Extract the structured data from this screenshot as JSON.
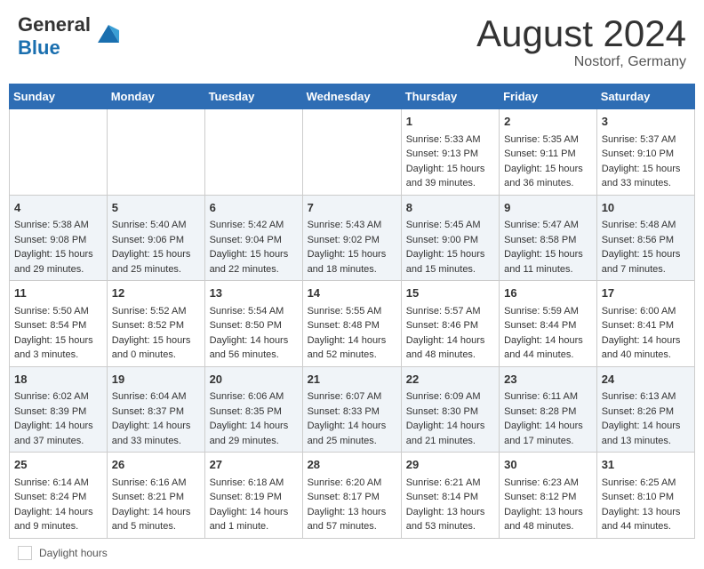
{
  "header": {
    "logo_line1": "General",
    "logo_line2": "Blue",
    "month_title": "August 2024",
    "location": "Nostorf, Germany"
  },
  "days_of_week": [
    "Sunday",
    "Monday",
    "Tuesday",
    "Wednesday",
    "Thursday",
    "Friday",
    "Saturday"
  ],
  "weeks": [
    [
      {
        "num": "",
        "sunrise": "",
        "sunset": "",
        "daylight": ""
      },
      {
        "num": "",
        "sunrise": "",
        "sunset": "",
        "daylight": ""
      },
      {
        "num": "",
        "sunrise": "",
        "sunset": "",
        "daylight": ""
      },
      {
        "num": "",
        "sunrise": "",
        "sunset": "",
        "daylight": ""
      },
      {
        "num": "1",
        "sunrise": "Sunrise: 5:33 AM",
        "sunset": "Sunset: 9:13 PM",
        "daylight": "Daylight: 15 hours and 39 minutes."
      },
      {
        "num": "2",
        "sunrise": "Sunrise: 5:35 AM",
        "sunset": "Sunset: 9:11 PM",
        "daylight": "Daylight: 15 hours and 36 minutes."
      },
      {
        "num": "3",
        "sunrise": "Sunrise: 5:37 AM",
        "sunset": "Sunset: 9:10 PM",
        "daylight": "Daylight: 15 hours and 33 minutes."
      }
    ],
    [
      {
        "num": "4",
        "sunrise": "Sunrise: 5:38 AM",
        "sunset": "Sunset: 9:08 PM",
        "daylight": "Daylight: 15 hours and 29 minutes."
      },
      {
        "num": "5",
        "sunrise": "Sunrise: 5:40 AM",
        "sunset": "Sunset: 9:06 PM",
        "daylight": "Daylight: 15 hours and 25 minutes."
      },
      {
        "num": "6",
        "sunrise": "Sunrise: 5:42 AM",
        "sunset": "Sunset: 9:04 PM",
        "daylight": "Daylight: 15 hours and 22 minutes."
      },
      {
        "num": "7",
        "sunrise": "Sunrise: 5:43 AM",
        "sunset": "Sunset: 9:02 PM",
        "daylight": "Daylight: 15 hours and 18 minutes."
      },
      {
        "num": "8",
        "sunrise": "Sunrise: 5:45 AM",
        "sunset": "Sunset: 9:00 PM",
        "daylight": "Daylight: 15 hours and 15 minutes."
      },
      {
        "num": "9",
        "sunrise": "Sunrise: 5:47 AM",
        "sunset": "Sunset: 8:58 PM",
        "daylight": "Daylight: 15 hours and 11 minutes."
      },
      {
        "num": "10",
        "sunrise": "Sunrise: 5:48 AM",
        "sunset": "Sunset: 8:56 PM",
        "daylight": "Daylight: 15 hours and 7 minutes."
      }
    ],
    [
      {
        "num": "11",
        "sunrise": "Sunrise: 5:50 AM",
        "sunset": "Sunset: 8:54 PM",
        "daylight": "Daylight: 15 hours and 3 minutes."
      },
      {
        "num": "12",
        "sunrise": "Sunrise: 5:52 AM",
        "sunset": "Sunset: 8:52 PM",
        "daylight": "Daylight: 15 hours and 0 minutes."
      },
      {
        "num": "13",
        "sunrise": "Sunrise: 5:54 AM",
        "sunset": "Sunset: 8:50 PM",
        "daylight": "Daylight: 14 hours and 56 minutes."
      },
      {
        "num": "14",
        "sunrise": "Sunrise: 5:55 AM",
        "sunset": "Sunset: 8:48 PM",
        "daylight": "Daylight: 14 hours and 52 minutes."
      },
      {
        "num": "15",
        "sunrise": "Sunrise: 5:57 AM",
        "sunset": "Sunset: 8:46 PM",
        "daylight": "Daylight: 14 hours and 48 minutes."
      },
      {
        "num": "16",
        "sunrise": "Sunrise: 5:59 AM",
        "sunset": "Sunset: 8:44 PM",
        "daylight": "Daylight: 14 hours and 44 minutes."
      },
      {
        "num": "17",
        "sunrise": "Sunrise: 6:00 AM",
        "sunset": "Sunset: 8:41 PM",
        "daylight": "Daylight: 14 hours and 40 minutes."
      }
    ],
    [
      {
        "num": "18",
        "sunrise": "Sunrise: 6:02 AM",
        "sunset": "Sunset: 8:39 PM",
        "daylight": "Daylight: 14 hours and 37 minutes."
      },
      {
        "num": "19",
        "sunrise": "Sunrise: 6:04 AM",
        "sunset": "Sunset: 8:37 PM",
        "daylight": "Daylight: 14 hours and 33 minutes."
      },
      {
        "num": "20",
        "sunrise": "Sunrise: 6:06 AM",
        "sunset": "Sunset: 8:35 PM",
        "daylight": "Daylight: 14 hours and 29 minutes."
      },
      {
        "num": "21",
        "sunrise": "Sunrise: 6:07 AM",
        "sunset": "Sunset: 8:33 PM",
        "daylight": "Daylight: 14 hours and 25 minutes."
      },
      {
        "num": "22",
        "sunrise": "Sunrise: 6:09 AM",
        "sunset": "Sunset: 8:30 PM",
        "daylight": "Daylight: 14 hours and 21 minutes."
      },
      {
        "num": "23",
        "sunrise": "Sunrise: 6:11 AM",
        "sunset": "Sunset: 8:28 PM",
        "daylight": "Daylight: 14 hours and 17 minutes."
      },
      {
        "num": "24",
        "sunrise": "Sunrise: 6:13 AM",
        "sunset": "Sunset: 8:26 PM",
        "daylight": "Daylight: 14 hours and 13 minutes."
      }
    ],
    [
      {
        "num": "25",
        "sunrise": "Sunrise: 6:14 AM",
        "sunset": "Sunset: 8:24 PM",
        "daylight": "Daylight: 14 hours and 9 minutes."
      },
      {
        "num": "26",
        "sunrise": "Sunrise: 6:16 AM",
        "sunset": "Sunset: 8:21 PM",
        "daylight": "Daylight: 14 hours and 5 minutes."
      },
      {
        "num": "27",
        "sunrise": "Sunrise: 6:18 AM",
        "sunset": "Sunset: 8:19 PM",
        "daylight": "Daylight: 14 hours and 1 minute."
      },
      {
        "num": "28",
        "sunrise": "Sunrise: 6:20 AM",
        "sunset": "Sunset: 8:17 PM",
        "daylight": "Daylight: 13 hours and 57 minutes."
      },
      {
        "num": "29",
        "sunrise": "Sunrise: 6:21 AM",
        "sunset": "Sunset: 8:14 PM",
        "daylight": "Daylight: 13 hours and 53 minutes."
      },
      {
        "num": "30",
        "sunrise": "Sunrise: 6:23 AM",
        "sunset": "Sunset: 8:12 PM",
        "daylight": "Daylight: 13 hours and 48 minutes."
      },
      {
        "num": "31",
        "sunrise": "Sunrise: 6:25 AM",
        "sunset": "Sunset: 8:10 PM",
        "daylight": "Daylight: 13 hours and 44 minutes."
      }
    ]
  ],
  "footer": {
    "daylight_label": "Daylight hours"
  }
}
